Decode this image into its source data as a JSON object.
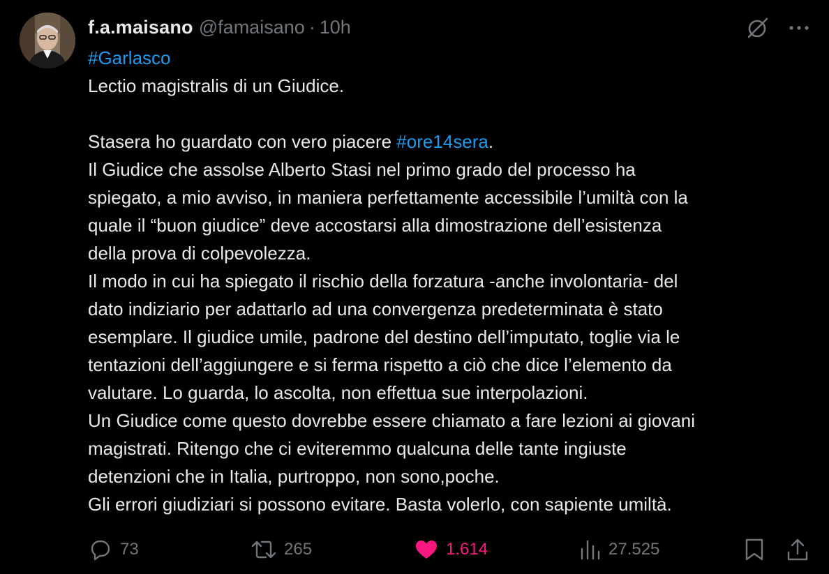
{
  "author": {
    "display_name": "f.a.maisano",
    "handle": "@famaisano",
    "separator": "·",
    "time": "10h",
    "avatar_icon": "profile-photo"
  },
  "top_actions": {
    "grok_icon": "grok-icon",
    "more_icon": "more-icon",
    "more_label": "···"
  },
  "tweet": {
    "hashtag_line": "#Garlasco",
    "line1": "Lectio magistralis di un Giudice.",
    "line2_before": "Stasera ho guardato con vero piacere ",
    "line2_hashtag": "#ore14sera",
    "line2_after": ".",
    "lines": [
      "Il Giudice che assolse Alberto Stasi nel primo grado del processo ha",
      "spiegato, a mio avviso, in maniera perfettamente accessibile l’umiltà con la",
      "quale il “buon giudice” deve accostarsi alla dimostrazione dell’esistenza",
      "della prova di colpevolezza.",
      "Il modo in cui ha spiegato il rischio della forzatura -anche involontaria- del",
      "dato indiziario per adattarlo ad una convergenza predeterminata è stato",
      "esemplare. Il giudice umile, padrone del destino dell’imputato, toglie via le",
      "tentazioni dell’aggiungere e si ferma rispetto a ciò che dice l’elemento da",
      "valutare. Lo guarda, lo ascolta, non effettua sue interpolazioni.",
      "Un Giudice come questo dovrebbe essere chiamato a fare lezioni ai giovani",
      "magistrati. Ritengo che ci eviteremmo qualcuna delle tante  ingiuste",
      "detenzioni che in Italia, purtroppo, non sono,poche.",
      "Gli errori giudiziari si possono evitare. Basta volerlo, con sapiente umiltà."
    ]
  },
  "actions": {
    "replies": "73",
    "reposts": "265",
    "likes": "1.614",
    "views": "27.525"
  },
  "colors": {
    "background": "#000000",
    "text": "#e7e9ea",
    "secondary": "#71767b",
    "link": "#1d9bf0",
    "like": "#f91880"
  }
}
